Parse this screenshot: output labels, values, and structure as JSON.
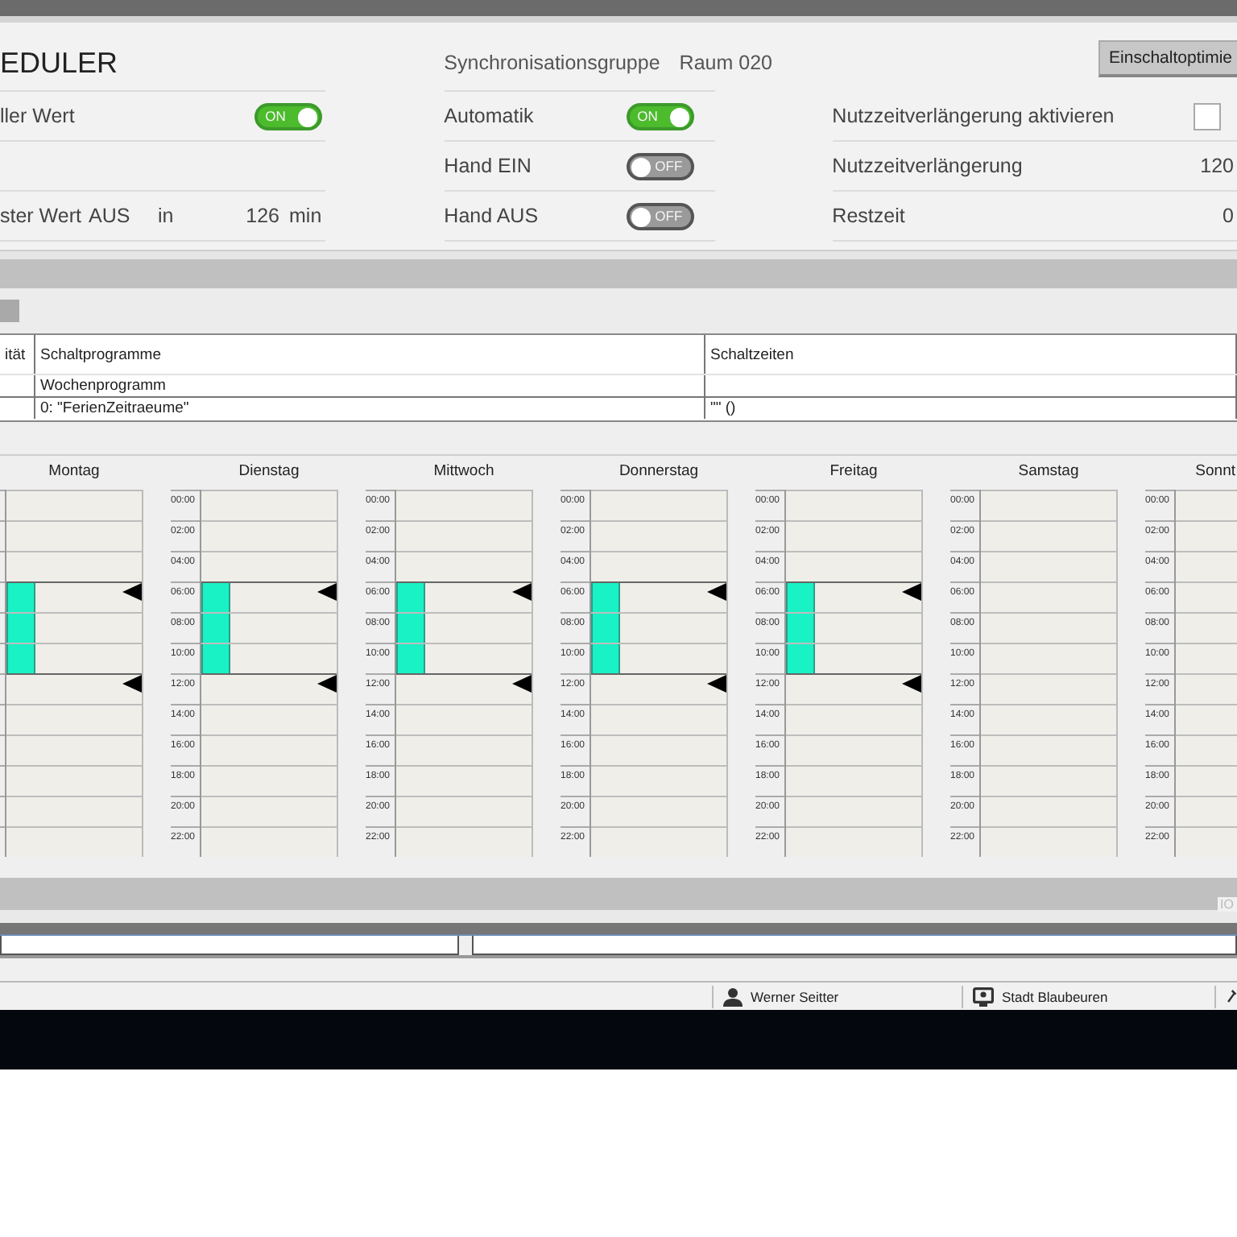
{
  "header": {
    "title": "EDULER",
    "sync_label": "Synchronisationsgruppe",
    "sync_value": "Raum 020",
    "optimize_button": "Einschaltoptimie"
  },
  "left_rows": [
    {
      "kind": "toggle",
      "label": "ller Wert",
      "on": true,
      "text": "ON"
    },
    {
      "kind": "empty"
    },
    {
      "kind": "next",
      "label": "ster Wert",
      "value": "AUS",
      "in": "in",
      "minutes": "126",
      "unit": "min"
    }
  ],
  "mode_rows": [
    {
      "label": "Automatik",
      "on": true,
      "text": "ON"
    },
    {
      "label": "Hand EIN",
      "on": false,
      "text": "OFF"
    },
    {
      "label": "Hand AUS",
      "on": false,
      "text": "OFF"
    }
  ],
  "right_rows": [
    {
      "kind": "checkbox",
      "label": "Nutzzeitverlängerung aktivieren",
      "checked": false
    },
    {
      "kind": "value",
      "label": "Nutzzeitverlängerung",
      "value": "120"
    },
    {
      "kind": "value",
      "label": "Restzeit",
      "value": "0"
    }
  ],
  "table": {
    "columns": [
      "ität",
      "Schaltprogramme",
      "Schaltzeiten"
    ],
    "rows": [
      [
        "",
        "Wochenprogramm",
        ""
      ],
      [
        "",
        "0: \"FerienZeitraeume\"",
        "\"\" ()"
      ]
    ]
  },
  "days": [
    {
      "name": "Montag",
      "slots": [
        {
          "on": false
        },
        {
          "on": false
        },
        {
          "on": false
        },
        {
          "on": true
        },
        {
          "on": true
        },
        {
          "on": true
        },
        {
          "on": false
        },
        {
          "on": false
        },
        {
          "on": false
        },
        {
          "on": false
        },
        {
          "on": false
        },
        {
          "on": false
        }
      ]
    },
    {
      "name": "Dienstag",
      "slots": [
        {
          "label": "00:00",
          "on": false
        },
        {
          "label": "02:00",
          "on": false
        },
        {
          "label": "04:00",
          "on": false
        },
        {
          "label": "06:00",
          "on": true
        },
        {
          "label": "08:00",
          "on": true
        },
        {
          "label": "10:00",
          "on": true
        },
        {
          "label": "12:00",
          "on": false
        },
        {
          "label": "14:00",
          "on": false
        },
        {
          "label": "16:00",
          "on": false
        },
        {
          "label": "18:00",
          "on": false
        },
        {
          "label": "20:00",
          "on": false
        },
        {
          "label": "22:00",
          "on": false
        }
      ]
    },
    {
      "name": "Mittwoch",
      "slots": [
        {
          "label": "00:00",
          "on": false
        },
        {
          "label": "02:00",
          "on": false
        },
        {
          "label": "04:00",
          "on": false
        },
        {
          "label": "06:00",
          "on": true
        },
        {
          "label": "08:00",
          "on": true
        },
        {
          "label": "10:00",
          "on": true
        },
        {
          "label": "12:00",
          "on": false
        },
        {
          "label": "14:00",
          "on": false
        },
        {
          "label": "16:00",
          "on": false
        },
        {
          "label": "18:00",
          "on": false
        },
        {
          "label": "20:00",
          "on": false
        },
        {
          "label": "22:00",
          "on": false
        }
      ]
    },
    {
      "name": "Donnerstag",
      "slots": [
        {
          "label": "00:00",
          "on": false
        },
        {
          "label": "02:00",
          "on": false
        },
        {
          "label": "04:00",
          "on": false
        },
        {
          "label": "06:00",
          "on": true
        },
        {
          "label": "08:00",
          "on": true
        },
        {
          "label": "10:00",
          "on": true
        },
        {
          "label": "12:00",
          "on": false
        },
        {
          "label": "14:00",
          "on": false
        },
        {
          "label": "16:00",
          "on": false
        },
        {
          "label": "18:00",
          "on": false
        },
        {
          "label": "20:00",
          "on": false
        },
        {
          "label": "22:00",
          "on": false
        }
      ]
    },
    {
      "name": "Freitag",
      "slots": [
        {
          "label": "00:00",
          "on": false
        },
        {
          "label": "02:00",
          "on": false
        },
        {
          "label": "04:00",
          "on": false
        },
        {
          "label": "06:00",
          "on": true
        },
        {
          "label": "08:00",
          "on": true
        },
        {
          "label": "10:00",
          "on": true
        },
        {
          "label": "12:00",
          "on": false
        },
        {
          "label": "14:00",
          "on": false
        },
        {
          "label": "16:00",
          "on": false
        },
        {
          "label": "18:00",
          "on": false
        },
        {
          "label": "20:00",
          "on": false
        },
        {
          "label": "22:00",
          "on": false
        }
      ]
    },
    {
      "name": "Samstag",
      "slots": [
        {
          "label": "00:00",
          "on": false
        },
        {
          "label": "02:00",
          "on": false
        },
        {
          "label": "04:00",
          "on": false
        },
        {
          "label": "06:00",
          "on": false
        },
        {
          "label": "08:00",
          "on": false
        },
        {
          "label": "10:00",
          "on": false
        },
        {
          "label": "12:00",
          "on": false
        },
        {
          "label": "14:00",
          "on": false
        },
        {
          "label": "16:00",
          "on": false
        },
        {
          "label": "18:00",
          "on": false
        },
        {
          "label": "20:00",
          "on": false
        },
        {
          "label": "22:00",
          "on": false
        }
      ]
    },
    {
      "name": "Sonnt",
      "slots": [
        {
          "label": "00:00",
          "on": false
        },
        {
          "label": "02:00",
          "on": false
        },
        {
          "label": "04:00",
          "on": false
        },
        {
          "label": "06:00",
          "on": false
        },
        {
          "label": "08:00",
          "on": false
        },
        {
          "label": "10:00",
          "on": false
        },
        {
          "label": "12:00",
          "on": false
        },
        {
          "label": "14:00",
          "on": false
        },
        {
          "label": "16:00",
          "on": false
        },
        {
          "label": "18:00",
          "on": false
        },
        {
          "label": "20:00",
          "on": false
        },
        {
          "label": "22:00",
          "on": false
        }
      ]
    }
  ],
  "band_tag": "IO",
  "status_bar": {
    "user": "Werner Seitter",
    "site": "Stadt Blaubeuren"
  }
}
